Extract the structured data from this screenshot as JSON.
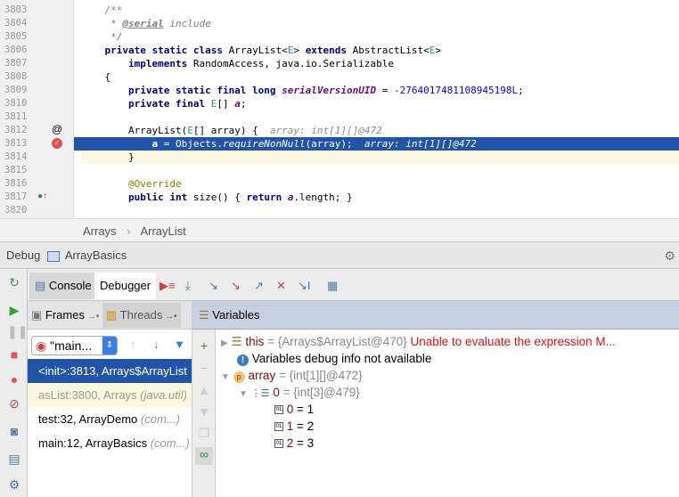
{
  "editor": {
    "lines": [
      {
        "n": "3803",
        "t": [
          [
            "    /**",
            "cm"
          ]
        ]
      },
      {
        "n": "3804",
        "t": [
          [
            "     * ",
            "cm"
          ],
          [
            "@serial",
            "doc"
          ],
          [
            " include",
            "cm"
          ]
        ]
      },
      {
        "n": "3805",
        "t": [
          [
            "     */",
            "cm"
          ]
        ]
      },
      {
        "n": "3806",
        "t": [
          [
            "    private static class ",
            "kw"
          ],
          [
            "ArrayList<",
            ""
          ],
          [
            "E",
            "ty"
          ],
          [
            "> ",
            ""
          ],
          [
            "extends ",
            "kw"
          ],
          [
            "AbstractList<",
            ""
          ],
          [
            "E",
            "ty"
          ],
          [
            ">",
            ""
          ]
        ]
      },
      {
        "n": "3807",
        "t": [
          [
            "        implements ",
            "kw"
          ],
          [
            "RandomAccess, java.io.Serializable",
            ""
          ]
        ]
      },
      {
        "n": "3808",
        "t": [
          [
            "    {",
            ""
          ]
        ]
      },
      {
        "n": "3809",
        "t": [
          [
            "        private static final long ",
            "kw"
          ],
          [
            "serialVersionUID",
            "fld"
          ],
          [
            " = ",
            ""
          ],
          [
            "-2764017481108945198L",
            "num"
          ],
          [
            ";",
            ""
          ]
        ]
      },
      {
        "n": "3810",
        "t": [
          [
            "        private final ",
            "kw"
          ],
          [
            "E",
            "ty"
          ],
          [
            "[] ",
            ""
          ],
          [
            "a",
            "fld"
          ],
          [
            ";",
            ""
          ]
        ]
      },
      {
        "n": "3811",
        "t": []
      },
      {
        "n": "3812",
        "t": [
          [
            "        ArrayList(",
            ""
          ],
          [
            "E",
            "ty"
          ],
          [
            "[] array) {  ",
            ""
          ],
          [
            "array: int[1][]@472",
            "hint"
          ]
        ]
      },
      {
        "n": "3813",
        "t": [
          [
            "            a",
            "kw"
          ],
          [
            " = Objects.",
            ""
          ],
          [
            "requireNonNull",
            "it"
          ],
          [
            "(array);  ",
            ""
          ],
          [
            "array: int[1][]@472",
            "hint"
          ]
        ]
      },
      {
        "n": "3814",
        "t": [
          [
            "        }",
            ""
          ]
        ]
      },
      {
        "n": "3815",
        "t": []
      },
      {
        "n": "3816",
        "t": [
          [
            "        @Override",
            "an"
          ]
        ]
      },
      {
        "n": "3817",
        "t": [
          [
            "        public int ",
            "kw"
          ],
          [
            "size() { ",
            ""
          ],
          [
            "return ",
            "kw"
          ],
          [
            "a",
            "fld"
          ],
          [
            ".length; }",
            ""
          ]
        ]
      },
      {
        "n": "3820",
        "t": []
      }
    ]
  },
  "breadcrumb": [
    "Arrays",
    "ArrayList"
  ],
  "breadcrumb_sep": "›",
  "debug": {
    "label": "Debug",
    "config": "ArrayBasics"
  },
  "tabs": {
    "console": "Console",
    "debugger": "Debugger"
  },
  "panels": {
    "frames": "Frames",
    "threads": "Threads",
    "variables": "Variables"
  },
  "thread_select": "\"main...",
  "frames": [
    {
      "main": "<init>:3813, Arrays$ArrayList",
      "pkg": "",
      "state": "selected"
    },
    {
      "main": "asList:3800, Arrays ",
      "pkg": "(java.util)",
      "state": "library"
    },
    {
      "main": "test:32, ArrayDemo ",
      "pkg": "(com...)",
      "state": "normal"
    },
    {
      "main": "main:12, ArrayBasics ",
      "pkg": "(com...)",
      "state": "normal"
    }
  ],
  "variables": {
    "this": {
      "name": "this",
      "value": " = {Arrays$ArrayList@470} ",
      "error": "Unable to evaluate the expression M..."
    },
    "info": "Variables debug info not available",
    "array": {
      "name": "array",
      "value": " = {int[1][]@472}"
    },
    "row0": {
      "name": "0",
      "value": " = {int[3]@479}"
    },
    "elems": [
      {
        "name": "0",
        "value": " = 1"
      },
      {
        "name": "1",
        "value": " = 2"
      },
      {
        "name": "2",
        "value": " = 3"
      }
    ]
  },
  "colors": {
    "selection": "#2154a8",
    "error": "#e01010",
    "keyword": "#000080"
  }
}
